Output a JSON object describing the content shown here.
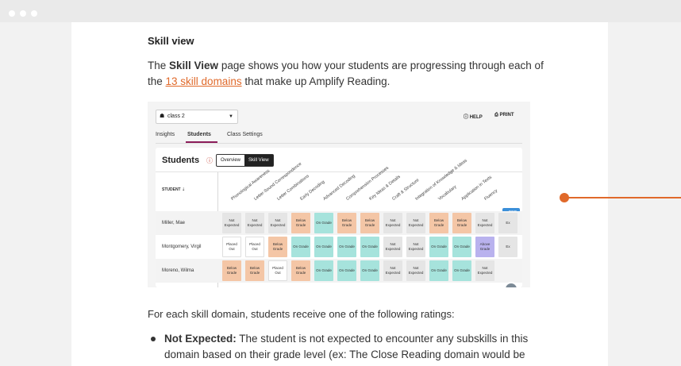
{
  "heading": "Skill view",
  "intro": {
    "p1": "The ",
    "bold": "Skill View",
    "p2": " page shows you how your students are progressing through each of the ",
    "link": "13 skill domains",
    "p3": " that make up Amplify Reading."
  },
  "shot": {
    "class_select": "class 2",
    "help": "HELP",
    "print": "PRINT",
    "tabs": [
      "Insights",
      "Students",
      "Class Settings"
    ],
    "card_title": "Students",
    "views": [
      "Overview",
      "Skill View"
    ],
    "student_header": "STUDENT",
    "columns": [
      "Phonological Awareness",
      "Letter-Sound Correspondence",
      "Letter Combinations",
      "Early Decoding",
      "Advanced Decoding",
      "Comprehension Processes",
      "Key Ideas & Details",
      "Craft & Structure",
      "Integration of Knowledge & Ideas",
      "Vocabulary",
      "Application in Texts",
      "Fluency"
    ],
    "top_button": "↑ TOP",
    "rows": [
      {
        "name": "Miller, Mae",
        "cells": [
          "Not Expected",
          "Not Expected",
          "Not Expected",
          "Below Grade",
          "On Grade",
          "Below Grade",
          "Below Grade",
          "Not Expected",
          "Not Expected",
          "Below Grade",
          "Below Grade",
          "Not Expected",
          "Ex"
        ]
      },
      {
        "name": "Montgomery, Virgil",
        "cells": [
          "Placed Out",
          "Placed Out",
          "Below Grade",
          "On Grade",
          "On Grade",
          "On Grade",
          "On Grade",
          "Not Expected",
          "Not Expected",
          "On Grade",
          "On Grade",
          "Above Grade",
          "Ex"
        ]
      },
      {
        "name": "Moreno, Wilma",
        "cells": [
          "Below Grade",
          "Below Grade",
          "Placed Out",
          "Below Grade",
          "On Grade",
          "On Grade",
          "On Grade",
          "Not Expected",
          "Not Expected",
          "On Grade",
          "On Grade",
          "Not Expected",
          ""
        ]
      }
    ],
    "colors": {
      "not_expected": "#e5e5e5",
      "below": "#f4c6a6",
      "on": "#a6e3dc",
      "placed": "#ffffff",
      "above": "#b9b2ee"
    }
  },
  "ratings_intro": "For each skill domain, students receive one of the following ratings:",
  "bullet": {
    "bold": "Not Expected:",
    "text": " The student is not expected to encounter any subskills in this domain based on their grade level (ex: The Close Reading domain would be Not"
  },
  "colors": {
    "accent": "#e0692a",
    "tab_active": "#8c1d5a"
  }
}
